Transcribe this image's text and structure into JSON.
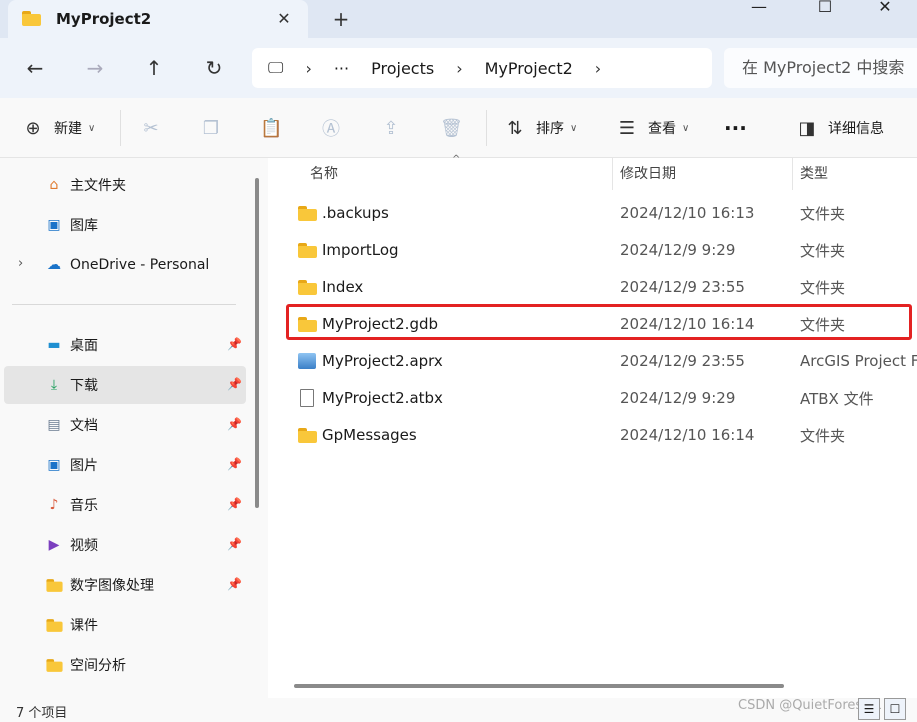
{
  "tab": {
    "title": "MyProject2",
    "close": "✕"
  },
  "new_tab": "+",
  "window_controls": {
    "minimize": "—",
    "maximize": "☐",
    "close": "✕"
  },
  "nav": {
    "back": "←",
    "forward": "→",
    "up": "↑",
    "refresh": "↻"
  },
  "address": {
    "device": "🖵",
    "chevron": "›",
    "ellipsis": "···",
    "segments": [
      "Projects",
      "MyProject2"
    ]
  },
  "search": {
    "placeholder": "在 MyProject2 中搜索"
  },
  "toolbar": {
    "new_label": "新建",
    "sort_label": "排序",
    "view_label": "查看",
    "more": "···",
    "details_label": "详细信息"
  },
  "sidebar": {
    "items": [
      {
        "label": "主文件夹",
        "icon": "home-icon"
      },
      {
        "label": "图库",
        "icon": "gallery-icon"
      },
      {
        "label": "OneDrive - Personal",
        "icon": "cloud-icon"
      },
      {
        "label": "桌面",
        "icon": "desktop-icon"
      },
      {
        "label": "下载",
        "icon": "download-icon"
      },
      {
        "label": "文档",
        "icon": "document-icon"
      },
      {
        "label": "图片",
        "icon": "pictures-icon"
      },
      {
        "label": "音乐",
        "icon": "music-icon"
      },
      {
        "label": "视频",
        "icon": "video-icon"
      },
      {
        "label": "数字图像处理",
        "icon": "folder-icon"
      },
      {
        "label": "课件",
        "icon": "folder-icon"
      },
      {
        "label": "空间分析",
        "icon": "folder-icon"
      }
    ]
  },
  "columns": {
    "name": "名称",
    "modified": "修改日期",
    "type": "类型"
  },
  "files": [
    {
      "name": ".backups",
      "modified": "2024/12/10 16:13",
      "type": "文件夹",
      "icon": "folder-icon"
    },
    {
      "name": "ImportLog",
      "modified": "2024/12/9 9:29",
      "type": "文件夹",
      "icon": "folder-icon"
    },
    {
      "name": "Index",
      "modified": "2024/12/9 23:55",
      "type": "文件夹",
      "icon": "folder-icon"
    },
    {
      "name": "MyProject2.gdb",
      "modified": "2024/12/10 16:14",
      "type": "文件夹",
      "icon": "folder-icon"
    },
    {
      "name": "MyProject2.aprx",
      "modified": "2024/12/9 23:55",
      "type": "ArcGIS Project F",
      "icon": "arcgis-project-icon"
    },
    {
      "name": "MyProject2.atbx",
      "modified": "2024/12/9 9:29",
      "type": "ATBX 文件",
      "icon": "file-icon"
    },
    {
      "name": "GpMessages",
      "modified": "2024/12/10 16:14",
      "type": "文件夹",
      "icon": "folder-icon"
    }
  ],
  "status": {
    "count": "7 个项目"
  },
  "watermark": "CSDN @QuietForest_L",
  "colors": {
    "highlight": "#e32222",
    "titlebar": "#dfe7f3",
    "accent": "#0067c0"
  }
}
